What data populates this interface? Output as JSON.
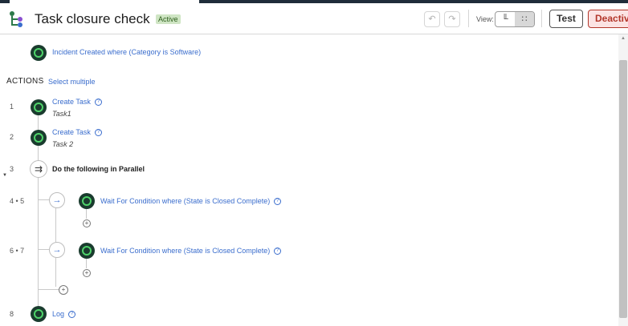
{
  "header": {
    "title": "Task closure check",
    "status_badge": "Active",
    "view_label": "View:",
    "test_label": "Test",
    "deactivate_label": "Deactivate"
  },
  "trigger": {
    "label": "Incident Created where (Category is Software)"
  },
  "actions_heading": "ACTIONS",
  "select_multiple": "Select multiple",
  "steps": [
    {
      "num": "1",
      "label": "Create Task",
      "sub": "Task1"
    },
    {
      "num": "2",
      "label": "Create Task",
      "sub": "Task 2"
    },
    {
      "num": "3",
      "label": "Do the following in Parallel"
    },
    {
      "num": "4 • 5",
      "label": "Wait For Condition where (State is Closed Complete)"
    },
    {
      "num": "6 • 7",
      "label": "Wait For Condition where (State is Closed Complete)"
    },
    {
      "num": "8",
      "label": "Log"
    }
  ],
  "icons": {
    "help": "?",
    "plus": "+",
    "arrow": "→",
    "parallel": "⇉",
    "undo": "↶",
    "redo": "↷"
  },
  "colors": {
    "accent": "#3a6dcd",
    "node_ring": "#4fd36a",
    "node_fill": "#1a3b2e",
    "deactivate": "#b3362a",
    "badge_bg": "#cfe5c4"
  }
}
